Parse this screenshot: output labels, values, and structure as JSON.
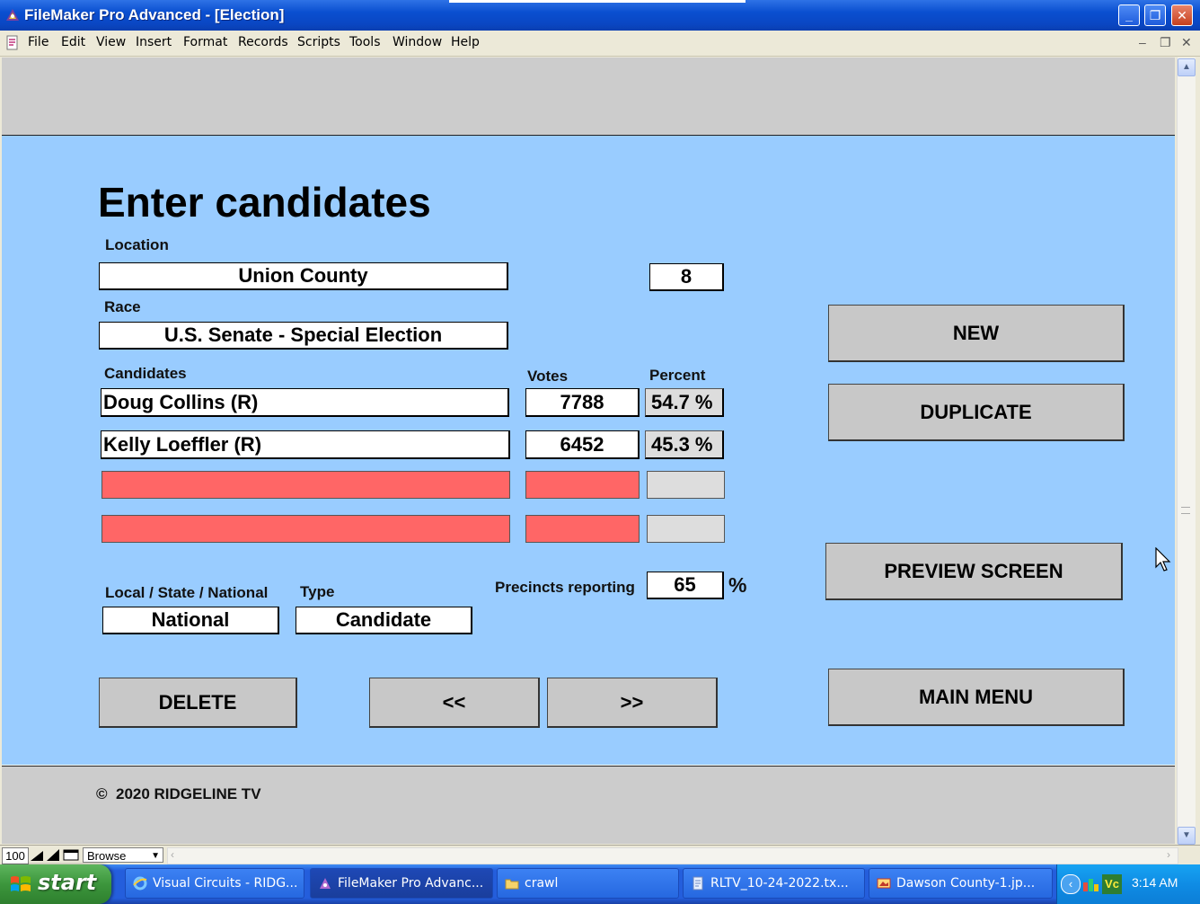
{
  "window": {
    "title": "FileMaker Pro Advanced - [Election]",
    "controls": {
      "minimize": "_",
      "maximize": "❐",
      "close": "✕"
    }
  },
  "menu": [
    "File",
    "Edit",
    "View",
    "Insert",
    "Format",
    "Records",
    "Scripts",
    "Tools",
    "Window",
    "Help"
  ],
  "mdi_controls": [
    "–",
    "❐",
    "✕"
  ],
  "form": {
    "heading": "Enter candidates",
    "location_label": "Location",
    "location": "Union County",
    "location_number": "8",
    "race_label": "Race",
    "race": "U.S. Senate - Special Election",
    "candidates_label": "Candidates",
    "votes_label": "Votes",
    "percent_label": "Percent",
    "candidates": [
      {
        "name": "Doug Collins (R)",
        "votes": "7788",
        "percent": "54.7 %"
      },
      {
        "name": "Kelly Loeffler (R)",
        "votes": "6452",
        "percent": "45.3 %"
      },
      {
        "name": "",
        "votes": "",
        "percent": ""
      },
      {
        "name": "",
        "votes": "",
        "percent": ""
      }
    ],
    "level_label": "Local / State / National",
    "level": "National",
    "type_label": "Type",
    "type": "Candidate",
    "precincts_label": "Precincts reporting",
    "precincts": "65",
    "percent_sign": "%"
  },
  "buttons": {
    "new": "NEW",
    "duplicate": "DUPLICATE",
    "preview": "PREVIEW SCREEN",
    "main_menu": "MAIN MENU",
    "delete": "DELETE",
    "prev": "<<",
    "next": ">>"
  },
  "footer": {
    "copyright_symbol": "©",
    "copyright": "2020 RIDGELINE TV"
  },
  "statusbar": {
    "zoom": "100",
    "mode": "Browse"
  },
  "taskbar": {
    "start": "start",
    "tasks": [
      "Visual Circuits - RIDG...",
      "FileMaker Pro Advanc...",
      "crawl",
      "RLTV_10-24-2022.tx...",
      "Dawson County-1.jp..."
    ],
    "clock": "3:14 AM"
  },
  "colors": {
    "panel": "#99CCFF",
    "band": "#CCCCCC",
    "empty_field": "#FF6666",
    "title_bar": "#0A4FD0"
  }
}
